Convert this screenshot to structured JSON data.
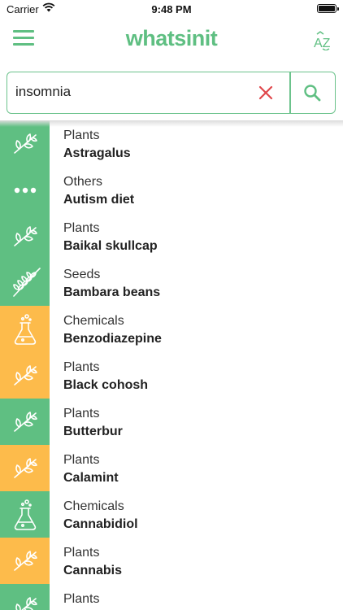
{
  "status": {
    "carrier": "Carrier",
    "time": "9:48 PM"
  },
  "header": {
    "logo": "whatsinit",
    "sort_label": "AZ"
  },
  "search": {
    "value": "insomnia"
  },
  "colors": {
    "green": "#5fbf82",
    "orange": "#fdbb4b"
  },
  "results": [
    {
      "category": "Plants",
      "name": "Astragalus",
      "icon": "plant-icon",
      "color": "#5fbf82"
    },
    {
      "category": "Others",
      "name": "Autism diet",
      "icon": "more-icon",
      "color": "#5fbf82"
    },
    {
      "category": "Plants",
      "name": "Baikal skullcap",
      "icon": "plant-icon",
      "color": "#5fbf82"
    },
    {
      "category": "Seeds",
      "name": "Bambara beans",
      "icon": "wheat-icon",
      "color": "#5fbf82"
    },
    {
      "category": "Chemicals",
      "name": "Benzodiazepine",
      "icon": "flask-icon",
      "color": "#fdbb4b"
    },
    {
      "category": "Plants",
      "name": "Black cohosh",
      "icon": "plant-icon",
      "color": "#fdbb4b"
    },
    {
      "category": "Plants",
      "name": "Butterbur",
      "icon": "plant-icon",
      "color": "#5fbf82"
    },
    {
      "category": "Plants",
      "name": "Calamint",
      "icon": "plant-icon",
      "color": "#fdbb4b"
    },
    {
      "category": "Chemicals",
      "name": "Cannabidiol",
      "icon": "flask-icon",
      "color": "#5fbf82"
    },
    {
      "category": "Plants",
      "name": "Cannabis",
      "icon": "plant-icon",
      "color": "#fdbb4b"
    },
    {
      "category": "Plants",
      "name": "",
      "icon": "plant-icon",
      "color": "#5fbf82"
    }
  ]
}
